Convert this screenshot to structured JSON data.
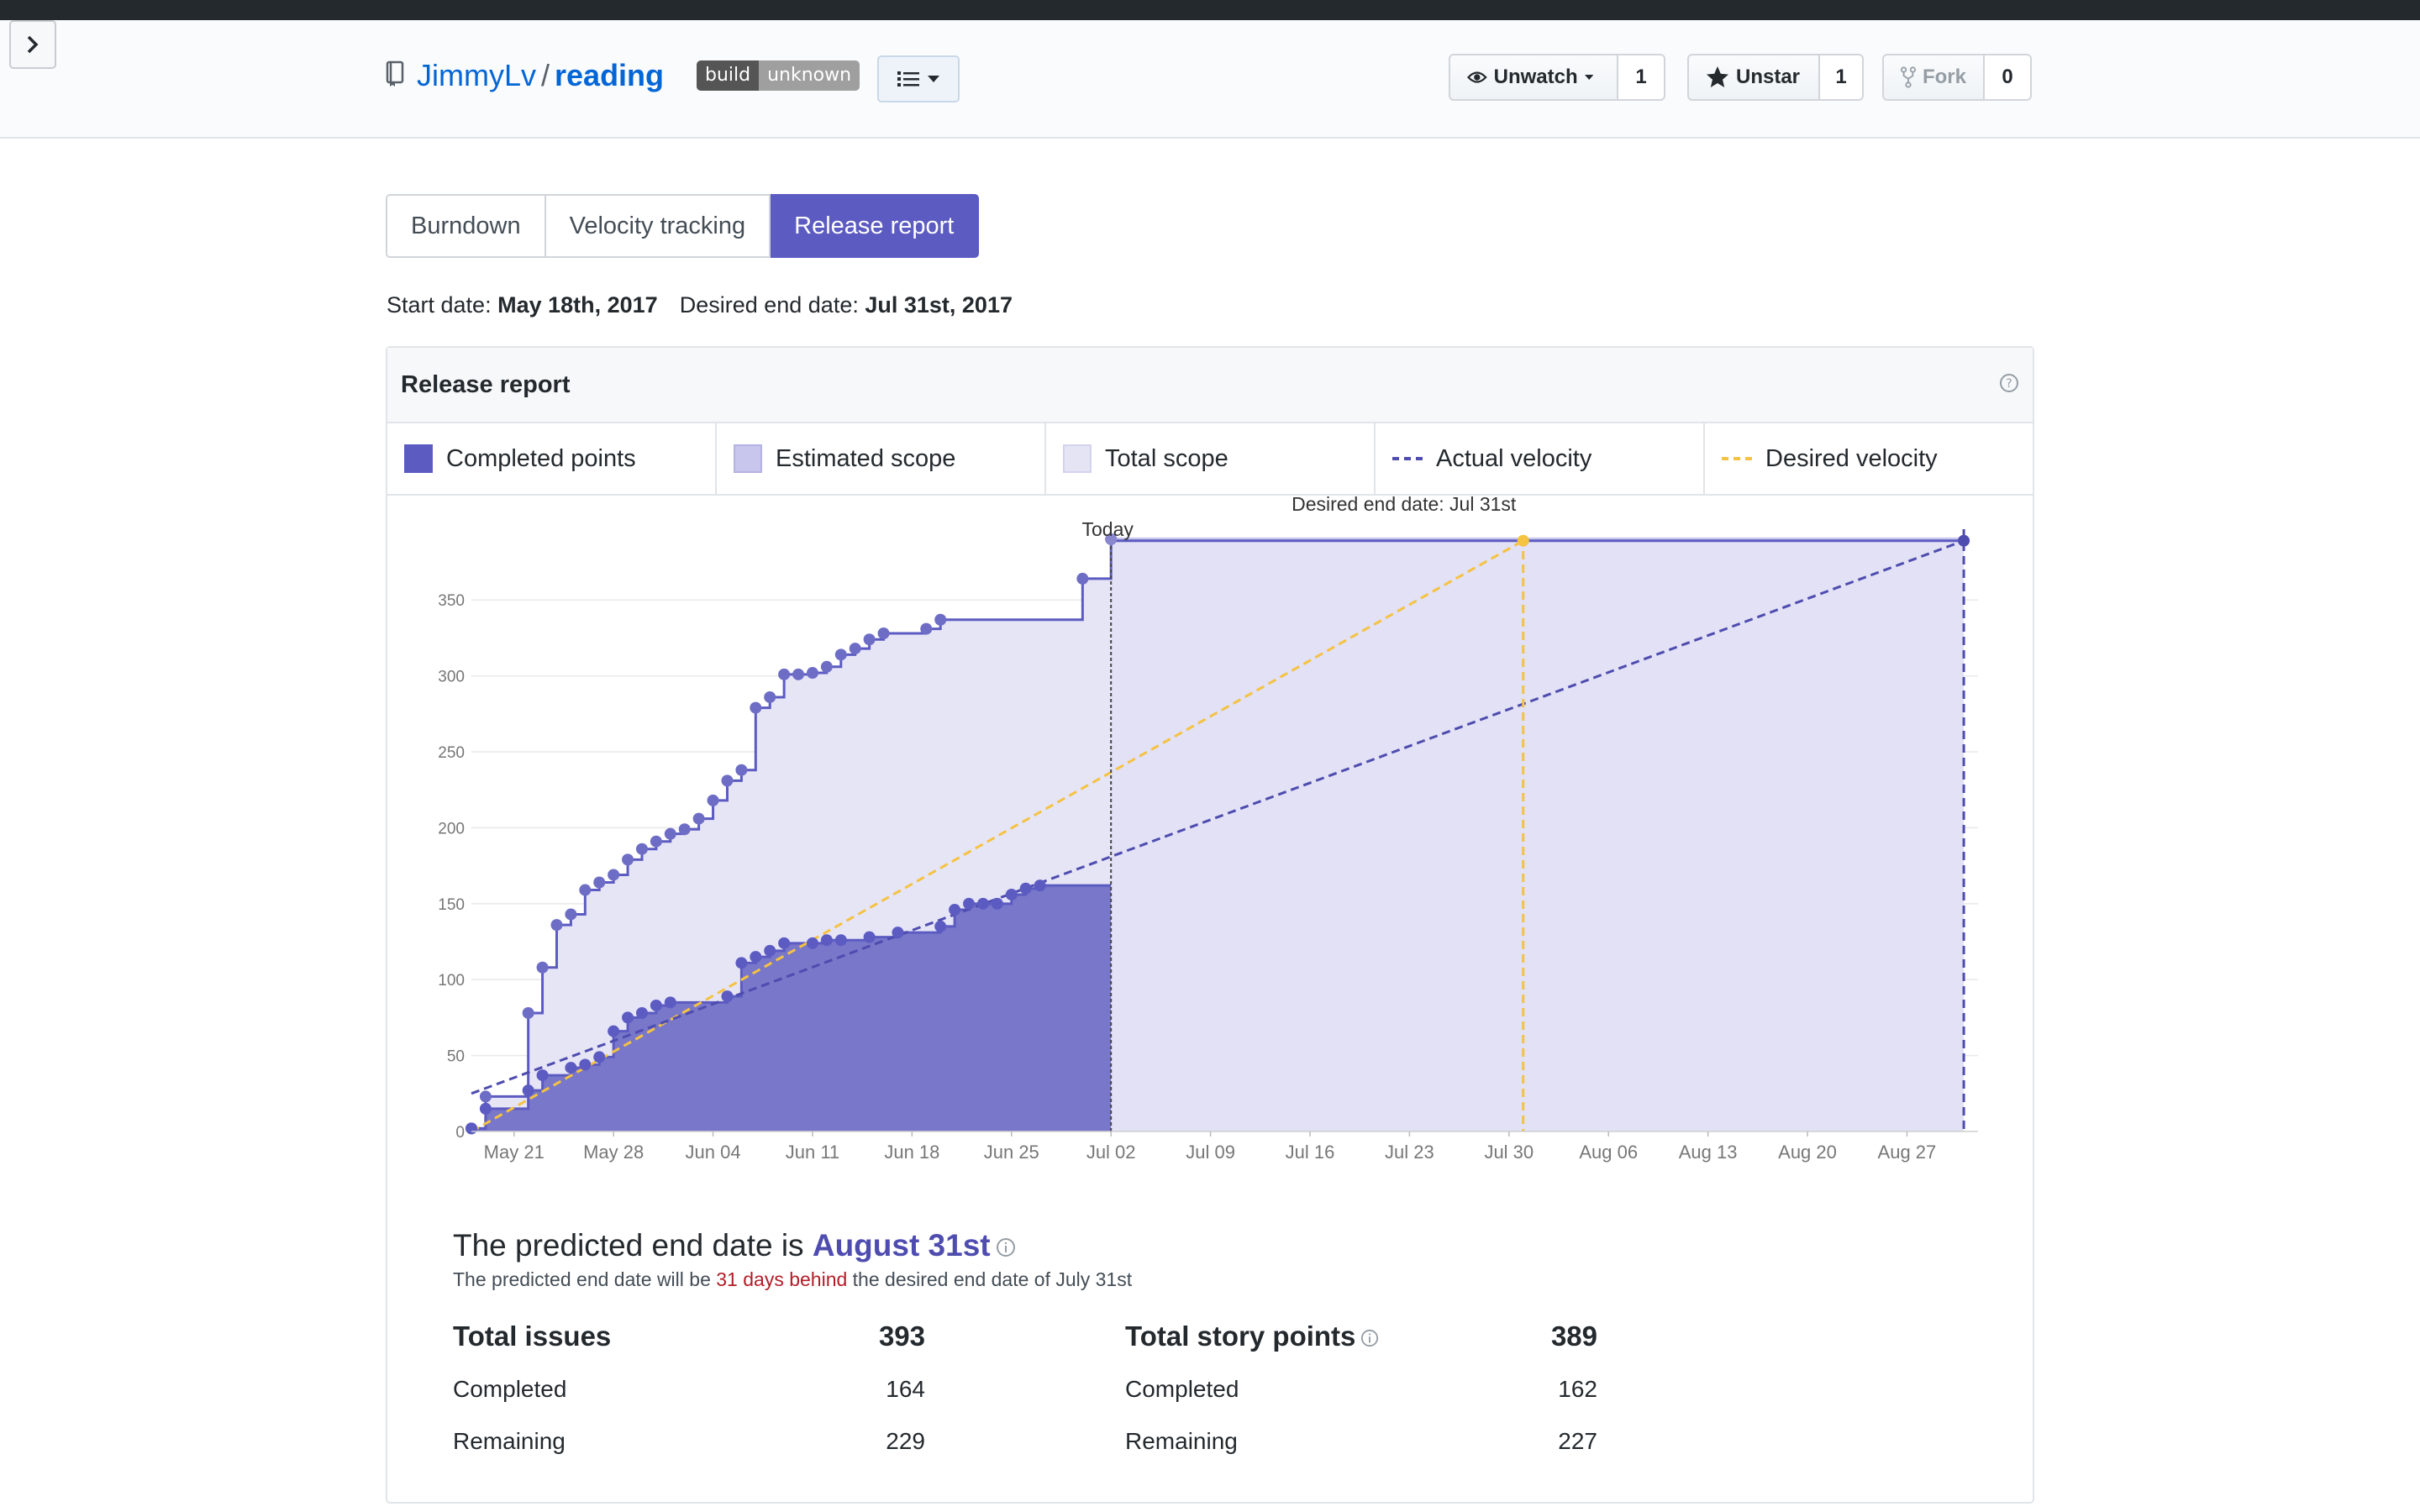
{
  "repo": {
    "owner": "JimmyLv",
    "separator": "/",
    "name": "reading"
  },
  "badge": {
    "label": "build",
    "status": "unknown"
  },
  "social": [
    {
      "label": "Unwatch",
      "count": "1",
      "icon": "eye-icon"
    },
    {
      "label": "Unstar",
      "count": "1",
      "icon": "star-icon"
    },
    {
      "label": "Fork",
      "count": "0",
      "icon": "fork-icon"
    }
  ],
  "tabs": [
    "Burndown",
    "Velocity tracking",
    "Release report"
  ],
  "dates": {
    "start_label": "Start date:",
    "start_value": "May 18th, 2017",
    "end_label": "Desired end date:",
    "end_value": "Jul 31st, 2017"
  },
  "panel": {
    "title": "Release report"
  },
  "legend": [
    {
      "label": "Completed points",
      "kind": "solid",
      "color": "#5c5bc2"
    },
    {
      "label": "Estimated scope",
      "kind": "solid",
      "color": "#c8c6ec"
    },
    {
      "label": "Total scope",
      "kind": "solid",
      "color": "#e4e4f5"
    },
    {
      "label": "Actual velocity",
      "kind": "dashed",
      "color": "#4e4caf"
    },
    {
      "label": "Desired velocity",
      "kind": "dashed",
      "color": "#f5c242"
    }
  ],
  "chart_data": {
    "type": "area",
    "title": "",
    "xlabel": "",
    "ylabel": "",
    "ylim": [
      0,
      380
    ],
    "yticks": [
      0,
      50,
      100,
      150,
      200,
      250,
      300,
      350
    ],
    "xlim": [
      "2017-05-18",
      "2017-09-01"
    ],
    "xticks": [
      "May 21",
      "May 28",
      "Jun 04",
      "Jun 11",
      "Jun 18",
      "Jun 25",
      "Jul 02",
      "Jul 09",
      "Jul 16",
      "Jul 23",
      "Jul 30",
      "Aug 06",
      "Aug 13",
      "Aug 20",
      "Aug 27"
    ],
    "xtick_dates": [
      "2017-05-21",
      "2017-05-28",
      "2017-06-04",
      "2017-06-11",
      "2017-06-18",
      "2017-06-25",
      "2017-07-02",
      "2017-07-09",
      "2017-07-16",
      "2017-07-23",
      "2017-07-30",
      "2017-08-06",
      "2017-08-13",
      "2017-08-20",
      "2017-08-27"
    ],
    "grid": true,
    "legend_position": "top",
    "annotations": {
      "today": "Today",
      "today_date": "2017-07-02",
      "desired_end": "Desired end date: Jul 31st",
      "desired_end_date": "2017-07-31",
      "predicted_end": "Predicted end date: Aug 31st",
      "predicted_end_date": "2017-08-31"
    },
    "series": [
      {
        "name": "Total scope",
        "x": [
          "2017-05-18",
          "2017-05-19",
          "2017-05-22",
          "2017-05-23",
          "2017-05-24",
          "2017-05-25",
          "2017-05-26",
          "2017-05-27",
          "2017-05-28",
          "2017-05-29",
          "2017-05-30",
          "2017-05-31",
          "2017-06-01",
          "2017-06-02",
          "2017-06-03",
          "2017-06-04",
          "2017-06-05",
          "2017-06-06",
          "2017-06-07",
          "2017-06-08",
          "2017-06-09",
          "2017-06-10",
          "2017-06-11",
          "2017-06-12",
          "2017-06-13",
          "2017-06-14",
          "2017-06-15",
          "2017-06-16",
          "2017-06-19",
          "2017-06-20",
          "2017-06-30",
          "2017-07-02"
        ],
        "values": [
          2,
          23,
          78,
          108,
          136,
          143,
          159,
          164,
          169,
          179,
          186,
          191,
          196,
          199,
          206,
          218,
          231,
          238,
          279,
          286,
          301,
          301,
          302,
          306,
          314,
          318,
          324,
          328,
          331,
          337,
          364,
          390
        ]
      },
      {
        "name": "Completed points",
        "x": [
          "2017-05-18",
          "2017-05-19",
          "2017-05-22",
          "2017-05-23",
          "2017-05-25",
          "2017-05-26",
          "2017-05-27",
          "2017-05-28",
          "2017-05-29",
          "2017-05-30",
          "2017-05-31",
          "2017-06-01",
          "2017-06-05",
          "2017-06-06",
          "2017-06-07",
          "2017-06-08",
          "2017-06-09",
          "2017-06-11",
          "2017-06-12",
          "2017-06-13",
          "2017-06-15",
          "2017-06-17",
          "2017-06-20",
          "2017-06-21",
          "2017-06-22",
          "2017-06-23",
          "2017-06-24",
          "2017-06-25",
          "2017-06-26",
          "2017-06-27"
        ],
        "values": [
          2,
          15,
          27,
          37,
          42,
          44,
          49,
          66,
          75,
          78,
          83,
          85,
          89,
          111,
          115,
          119,
          124,
          124,
          126,
          126,
          128,
          131,
          135,
          146,
          150,
          150,
          150,
          156,
          160,
          162
        ]
      },
      {
        "name": "Desired velocity",
        "x": [
          "2017-05-18",
          "2017-07-31"
        ],
        "values": [
          0,
          389
        ]
      },
      {
        "name": "Actual velocity",
        "x": [
          "2017-05-18",
          "2017-08-31"
        ],
        "values": [
          25,
          389
        ]
      }
    ]
  },
  "summary": {
    "headline_prefix": "The predicted end date is",
    "headline_date": "August 31st",
    "sub_prefix": "The predicted end date will be",
    "sub_red": "31 days behind",
    "sub_suffix": "the desired end date of July 31st"
  },
  "issues": {
    "title": "Total issues",
    "total": "393",
    "completed_label": "Completed",
    "completed": "164",
    "remaining_label": "Remaining",
    "remaining": "229"
  },
  "points": {
    "title": "Total story points",
    "total": "389",
    "completed_label": "Completed",
    "completed": "162",
    "remaining_label": "Remaining",
    "remaining": "227"
  }
}
